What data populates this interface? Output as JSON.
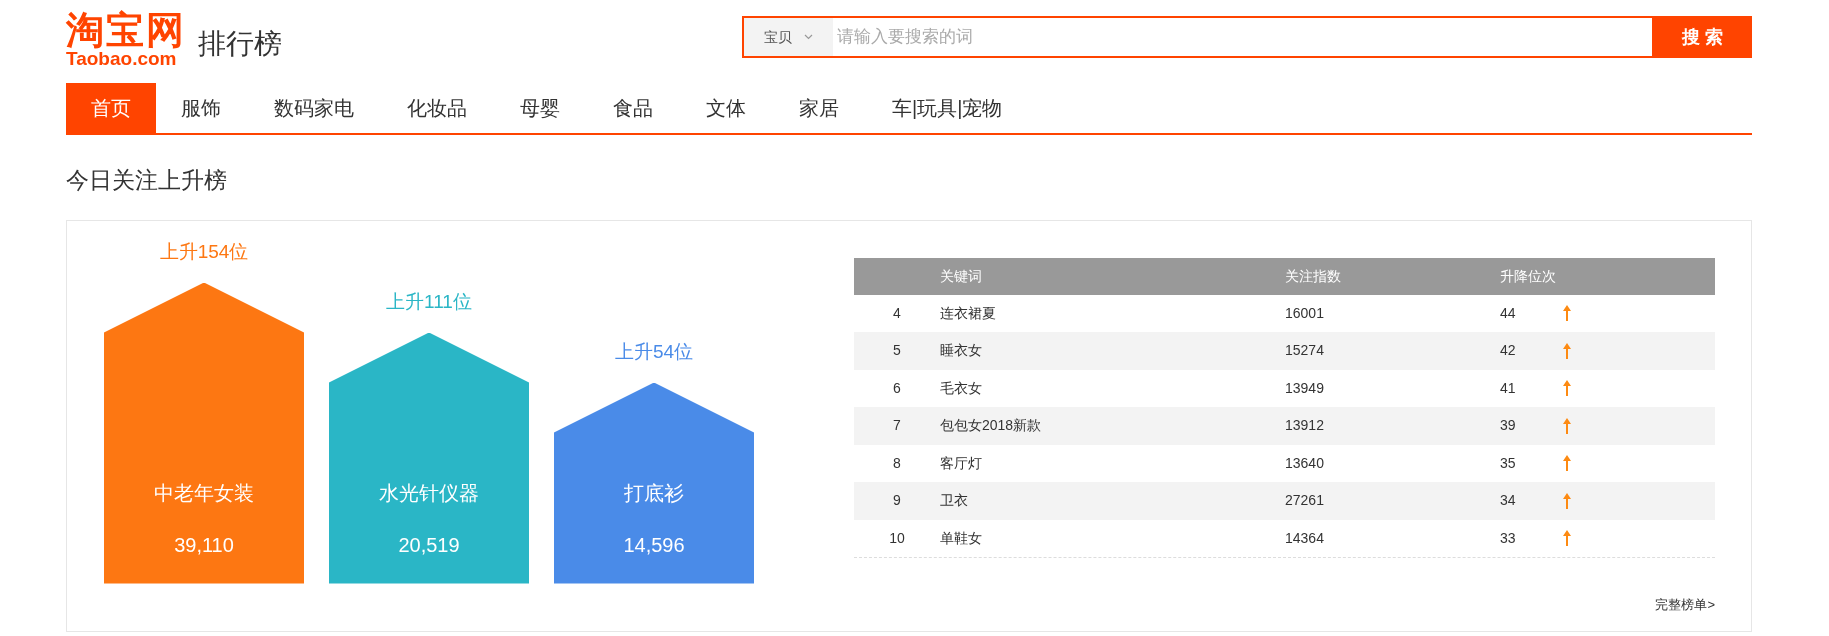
{
  "logo": {
    "mark": "淘宝网",
    "domain": "Taobao.com"
  },
  "site_title": "排行榜",
  "search": {
    "scope": "宝贝",
    "placeholder": "请输入要搜索的词",
    "button": "搜 索"
  },
  "nav": [
    {
      "label": "首页",
      "selected": true
    },
    {
      "label": "服饰",
      "selected": false
    },
    {
      "label": "数码家电",
      "selected": false
    },
    {
      "label": "化妆品",
      "selected": false
    },
    {
      "label": "母婴",
      "selected": false
    },
    {
      "label": "食品",
      "selected": false
    },
    {
      "label": "文体",
      "selected": false
    },
    {
      "label": "家居",
      "selected": false
    },
    {
      "label": "车|玩具|宠物",
      "selected": false
    }
  ],
  "section_title": "今日关注上升榜",
  "top3": [
    {
      "rise": "上升154位",
      "name": "中老年女装",
      "index": "39,110",
      "color": "#fd7712"
    },
    {
      "rise": "上升111位",
      "name": "水光针仪器",
      "index": "20,519",
      "color": "#2ab6c6"
    },
    {
      "rise": "上升54位",
      "name": "打底衫",
      "index": "14,596",
      "color": "#4a8be8"
    }
  ],
  "table": {
    "columns": [
      "关键词",
      "关注指数",
      "升降位次"
    ],
    "rows": [
      {
        "rank": "4",
        "keyword": "连衣裙夏",
        "index": "16001",
        "change": "44"
      },
      {
        "rank": "5",
        "keyword": "睡衣女",
        "index": "15274",
        "change": "42"
      },
      {
        "rank": "6",
        "keyword": "毛衣女",
        "index": "13949",
        "change": "41"
      },
      {
        "rank": "7",
        "keyword": "包包女2018新款",
        "index": "13912",
        "change": "39"
      },
      {
        "rank": "8",
        "keyword": "客厅灯",
        "index": "13640",
        "change": "35"
      },
      {
        "rank": "9",
        "keyword": "卫衣",
        "index": "27261",
        "change": "34"
      },
      {
        "rank": "10",
        "keyword": "单鞋女",
        "index": "14364",
        "change": "33"
      }
    ]
  },
  "full_list_link": "完整榜单>"
}
